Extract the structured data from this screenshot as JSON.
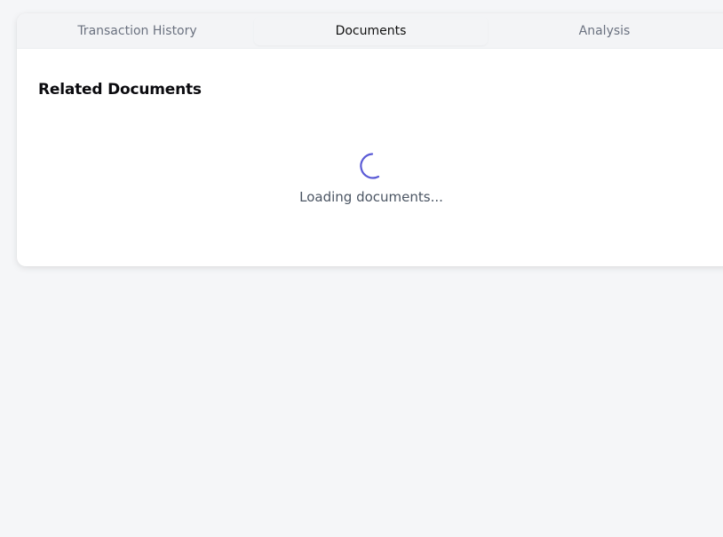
{
  "tabs": [
    {
      "label": "Transaction History",
      "active": false
    },
    {
      "label": "Documents",
      "active": true
    },
    {
      "label": "Analysis",
      "active": false
    }
  ],
  "section": {
    "title": "Related Documents"
  },
  "loading": {
    "text": "Loading documents...",
    "spinner_icon": "spinner-icon",
    "accent_color": "#5b5bd6"
  }
}
